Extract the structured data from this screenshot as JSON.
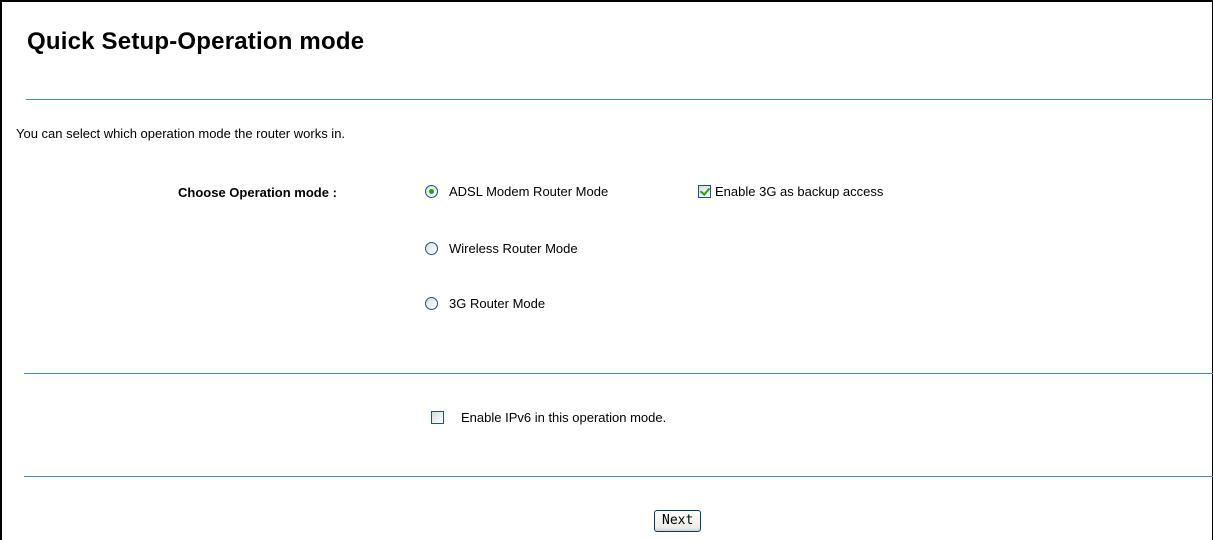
{
  "page": {
    "title": "Quick Setup-Operation mode",
    "description": "You can select which operation mode the router works in."
  },
  "operation_mode": {
    "label": "Choose Operation mode :",
    "options": [
      {
        "label": "ADSL Modem Router Mode",
        "selected": true
      },
      {
        "label": "Wireless Router Mode",
        "selected": false
      },
      {
        "label": "3G Router Mode",
        "selected": false
      }
    ],
    "backup_3g": {
      "label": "Enable 3G as backup access",
      "checked": true
    }
  },
  "ipv6": {
    "label": "Enable IPv6 in this operation mode.",
    "checked": false
  },
  "actions": {
    "next_label": "Next"
  },
  "colors": {
    "divider": "#3d8fc2",
    "check_mark": "#21a121",
    "control_border": "#1c5180"
  }
}
